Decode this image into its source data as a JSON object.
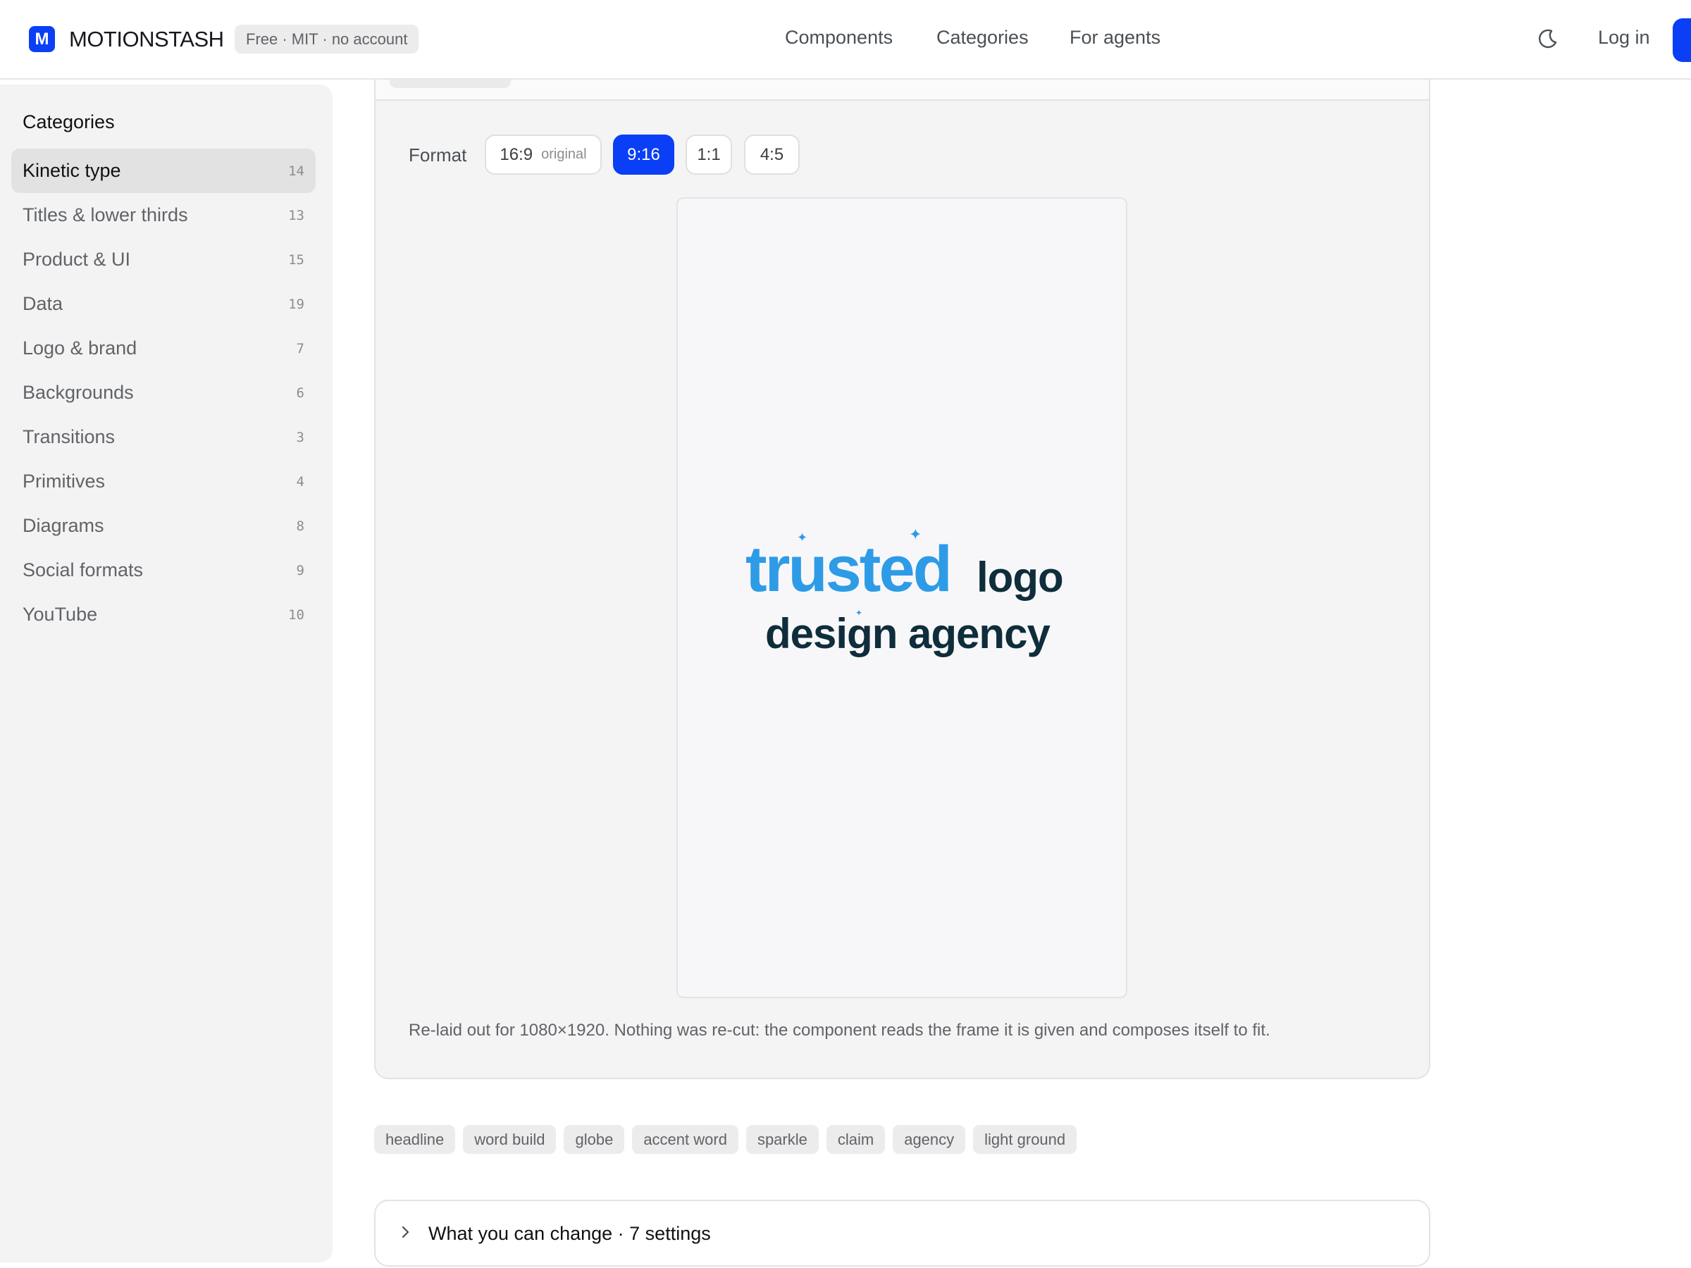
{
  "brand": {
    "logo_letter": "M",
    "name": "MOTIONSTASH",
    "badge": "Free · MIT · no account"
  },
  "nav": {
    "links": [
      "Components",
      "Categories",
      "For agents"
    ],
    "theme_icon": "moon-icon",
    "login": "Log in"
  },
  "sidebar": {
    "title": "Categories",
    "items": [
      {
        "label": "Kinetic type",
        "count": "14",
        "active": true
      },
      {
        "label": "Titles & lower thirds",
        "count": "13"
      },
      {
        "label": "Product & UI",
        "count": "15"
      },
      {
        "label": "Data",
        "count": "19"
      },
      {
        "label": "Logo & brand",
        "count": "7"
      },
      {
        "label": "Backgrounds",
        "count": "6"
      },
      {
        "label": "Transitions",
        "count": "3"
      },
      {
        "label": "Primitives",
        "count": "4"
      },
      {
        "label": "Diagrams",
        "count": "8"
      },
      {
        "label": "Social formats",
        "count": "9"
      },
      {
        "label": "YouTube",
        "count": "10"
      }
    ]
  },
  "preview": {
    "format_label": "Format",
    "formats": [
      {
        "label": "16:9",
        "sub": "original"
      },
      {
        "label": "9:16",
        "selected": true
      },
      {
        "label": "1:1"
      },
      {
        "label": "4:5"
      }
    ],
    "headline": {
      "accent_word": "trusted",
      "word2": "logo",
      "line2": "design agency",
      "icon": "sparkle-icon"
    },
    "caption": "Re-laid out for 1080×1920. Nothing was re-cut: the component reads the frame it is given and composes itself to fit."
  },
  "tags": [
    "headline",
    "word build",
    "globe",
    "accent word",
    "sparkle",
    "claim",
    "agency",
    "light ground"
  ],
  "settings": {
    "label": "What you can change · 7 settings",
    "icon": "chevron-right-icon"
  },
  "colors": {
    "brand_blue": "#0a3ff5",
    "accent_blue": "#2e9be6",
    "headline_dark": "#0f2d3a"
  }
}
